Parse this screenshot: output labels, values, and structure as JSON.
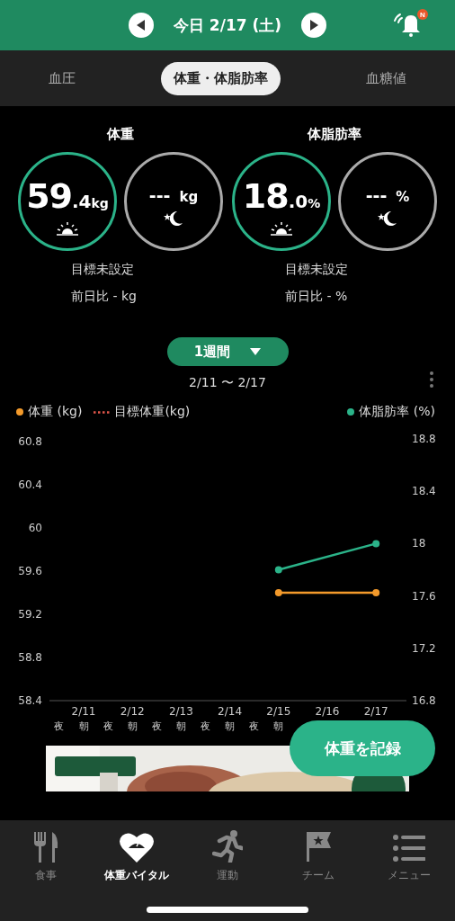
{
  "header": {
    "date": "今日 2/17 (土)",
    "notification_badge": "N"
  },
  "tabs": [
    {
      "label": "血圧",
      "selected": false
    },
    {
      "label": "体重・体脂肪率",
      "selected": true
    },
    {
      "label": "血糖値",
      "selected": false
    }
  ],
  "metrics": [
    {
      "title": "体重",
      "goal": "目標未設定",
      "diff": "前日比  - kg",
      "readings": [
        {
          "kind": "morning",
          "active": true,
          "value_main": "59",
          "value_decimal": ".4",
          "unit": "kg"
        },
        {
          "kind": "night",
          "active": false,
          "value_main": "---",
          "unit": "kg"
        }
      ]
    },
    {
      "title": "体脂肪率",
      "goal": "目標未設定",
      "diff": "前日比  - %",
      "readings": [
        {
          "kind": "morning",
          "active": true,
          "value_main": "18",
          "value_decimal": ".0",
          "unit": "%"
        },
        {
          "kind": "night",
          "active": false,
          "value_main": "---",
          "unit": "%"
        }
      ]
    }
  ],
  "period": {
    "label": "1週間",
    "range": "2/11 〜 2/17"
  },
  "target_legend": {
    "label": "目標体重(kg)",
    "color": "#e0564a"
  },
  "chart_periods": [
    "夜",
    "朝",
    "夜",
    "朝",
    "夜",
    "朝",
    "夜",
    "朝",
    "夜",
    "朝"
  ],
  "chart_data": {
    "type": "line",
    "categories": [
      "2/11",
      "2/12",
      "2/13",
      "2/14",
      "2/15",
      "2/16",
      "2/17"
    ],
    "yticks": [
      58.4,
      58.8,
      59.2,
      59.6,
      60,
      60.4,
      60.8
    ],
    "ylim": [
      58.4,
      60.8
    ],
    "y2ticks": [
      16.8,
      17.2,
      17.6,
      18,
      18.4,
      18.8
    ],
    "y2lim": [
      16.8,
      18.8
    ],
    "series": [
      {
        "name": "体重 (kg)",
        "color": "#f39a2b",
        "marker": "circle",
        "values": [
          null,
          null,
          null,
          null,
          59.4,
          null,
          59.4
        ]
      },
      {
        "name": "体脂肪率 (%)",
        "color": "#2bb389",
        "axis": "y2",
        "marker": "circle",
        "values": [
          null,
          null,
          null,
          null,
          17.8,
          null,
          18.0
        ]
      }
    ]
  },
  "record_button": "体重を記録",
  "nav": [
    {
      "kind": "fork",
      "label": "食事",
      "selected": false
    },
    {
      "kind": "heart",
      "label": "体重バイタル",
      "selected": true
    },
    {
      "kind": "run",
      "label": "運動",
      "selected": false
    },
    {
      "kind": "flag",
      "label": "チーム",
      "selected": false
    },
    {
      "kind": "list",
      "label": "メニュー",
      "selected": false
    }
  ]
}
